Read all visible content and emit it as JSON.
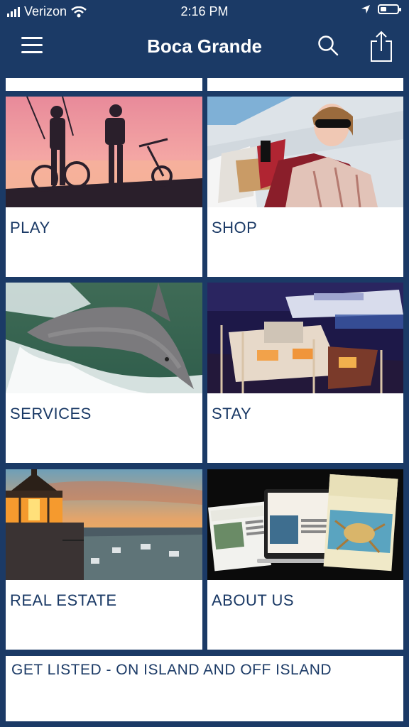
{
  "status_bar": {
    "carrier": "Verizon",
    "time": "2:16 PM",
    "battery_level": 0.35
  },
  "nav": {
    "title": "Boca Grande",
    "icons": [
      "menu-icon",
      "search-icon",
      "share-icon"
    ]
  },
  "tiles": [
    {
      "label": "PLAY",
      "image": "bikes-sunset"
    },
    {
      "label": "SHOP",
      "image": "shopping-woman"
    },
    {
      "label": "SERVICES",
      "image": "dolphin"
    },
    {
      "label": "STAY",
      "image": "marina-night"
    },
    {
      "label": "REAL ESTATE",
      "image": "lighthouse-sunset"
    },
    {
      "label": "ABOUT US",
      "image": "newspapers"
    }
  ],
  "banner": {
    "label": "GET LISTED - ON ISLAND AND OFF ISLAND"
  },
  "colors": {
    "brand": "#1b3a66",
    "tile_bg": "#ffffff",
    "label": "#1b3a66"
  }
}
